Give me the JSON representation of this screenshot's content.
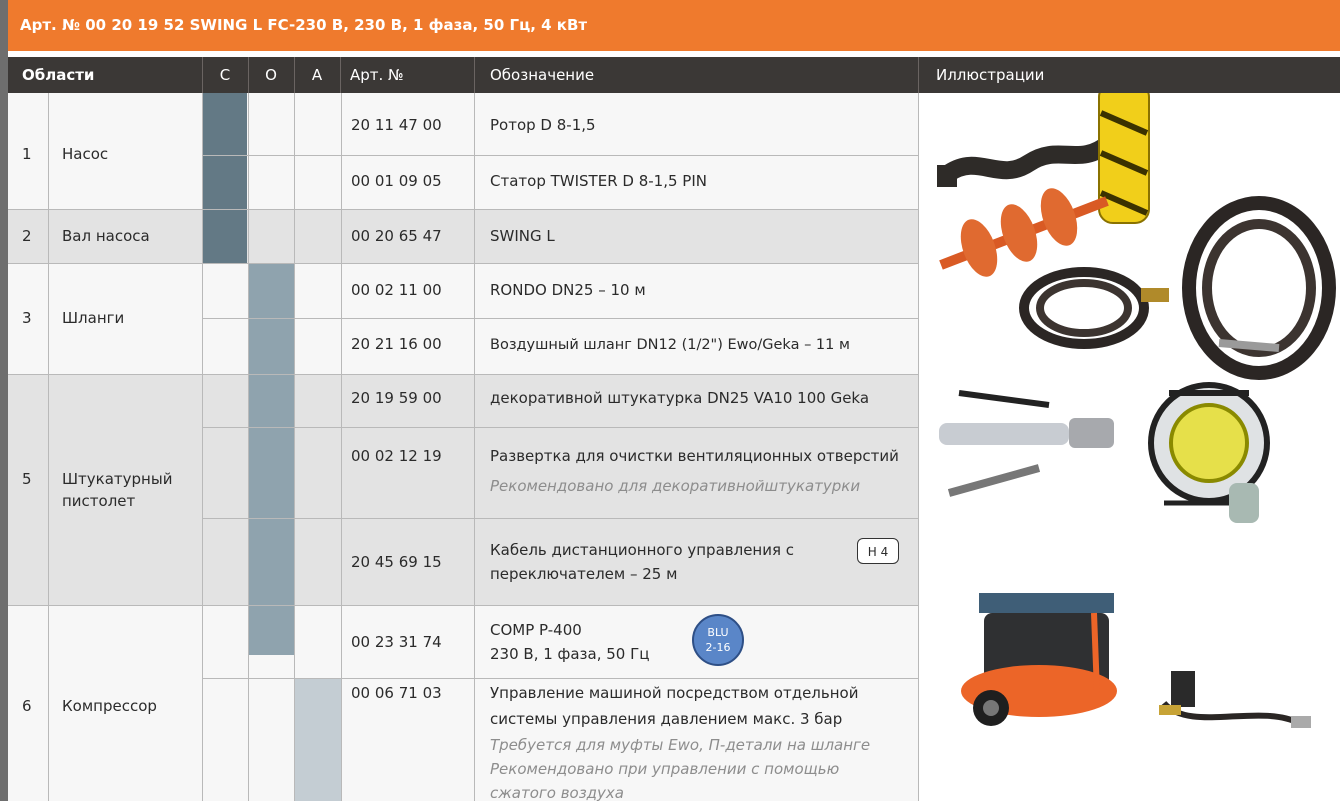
{
  "title": "Арт. № 00 20 19 52 SWING L FC-230 В, 230 В, 1 фаза, 50 Гц, 4 кВт",
  "header": {
    "areas": "Области",
    "c": "C",
    "o": "O",
    "a": "A",
    "art": "Арт. №",
    "designation": "Обозначение",
    "illustrations": "Иллюстрации"
  },
  "groups": [
    {
      "num": "1",
      "name": "Насос"
    },
    {
      "num": "2",
      "name": "Вал насоса"
    },
    {
      "num": "3",
      "name": "Шланги"
    },
    {
      "num": "5",
      "name": "Штукатурный пистолет"
    },
    {
      "num": "6",
      "name": "Компрессор"
    }
  ],
  "rows": [
    {
      "art": "20 11 47 00",
      "desc": "Ротор D 8-1,5",
      "note": ""
    },
    {
      "art": "00 01 09 05",
      "desc": "Статор TWISTER D 8-1,5 PIN",
      "note": ""
    },
    {
      "art": "00 20 65 47",
      "desc": "SWING L",
      "note": ""
    },
    {
      "art": "00 02 11 00",
      "desc": "RONDO DN25 – 10 м",
      "note": ""
    },
    {
      "art": "20 21 16 00",
      "desc": "Воздушный шланг DN12 (1/2\") Ewo/Geka – 11 м",
      "note": ""
    },
    {
      "art": "20 19 59 00",
      "desc": "декоративной штукатурка DN25 VA10 100 Geka",
      "note": ""
    },
    {
      "art": "00 02 12 19",
      "desc": "Развертка для очистки вентиляционных отверстий",
      "note": "Рекомендовано для декоративнойштукатурки"
    },
    {
      "art": "20 45 69 15",
      "desc_line1": "Кабель дистанционного управления с",
      "desc_line2": "переключателем – 25 м",
      "badge": "H 4"
    },
    {
      "art": "00 23 31 74",
      "desc_line1": "COMP P-400",
      "desc_line2": "230 В, 1 фаза, 50 Гц",
      "badge_line1": "BLU",
      "badge_line2": "2-16"
    },
    {
      "art": "00 06 71 03",
      "desc_line1": "Управление машиной посредством отдельной",
      "desc_line2": "системы управления давлением макс. 3 бар",
      "note_line1": "Требуется для муфты Ewo, П-детали на шланге",
      "note_line2": "Рекомендовано при управлении с помощью",
      "note_line3": "сжатого воздуха"
    }
  ],
  "colors": {
    "title_bg": "#ef7a2d",
    "header_bg": "#3b3836",
    "fill_c": "#637985",
    "fill_o": "#8fa3ae",
    "fill_a": "#c4cdd3"
  }
}
